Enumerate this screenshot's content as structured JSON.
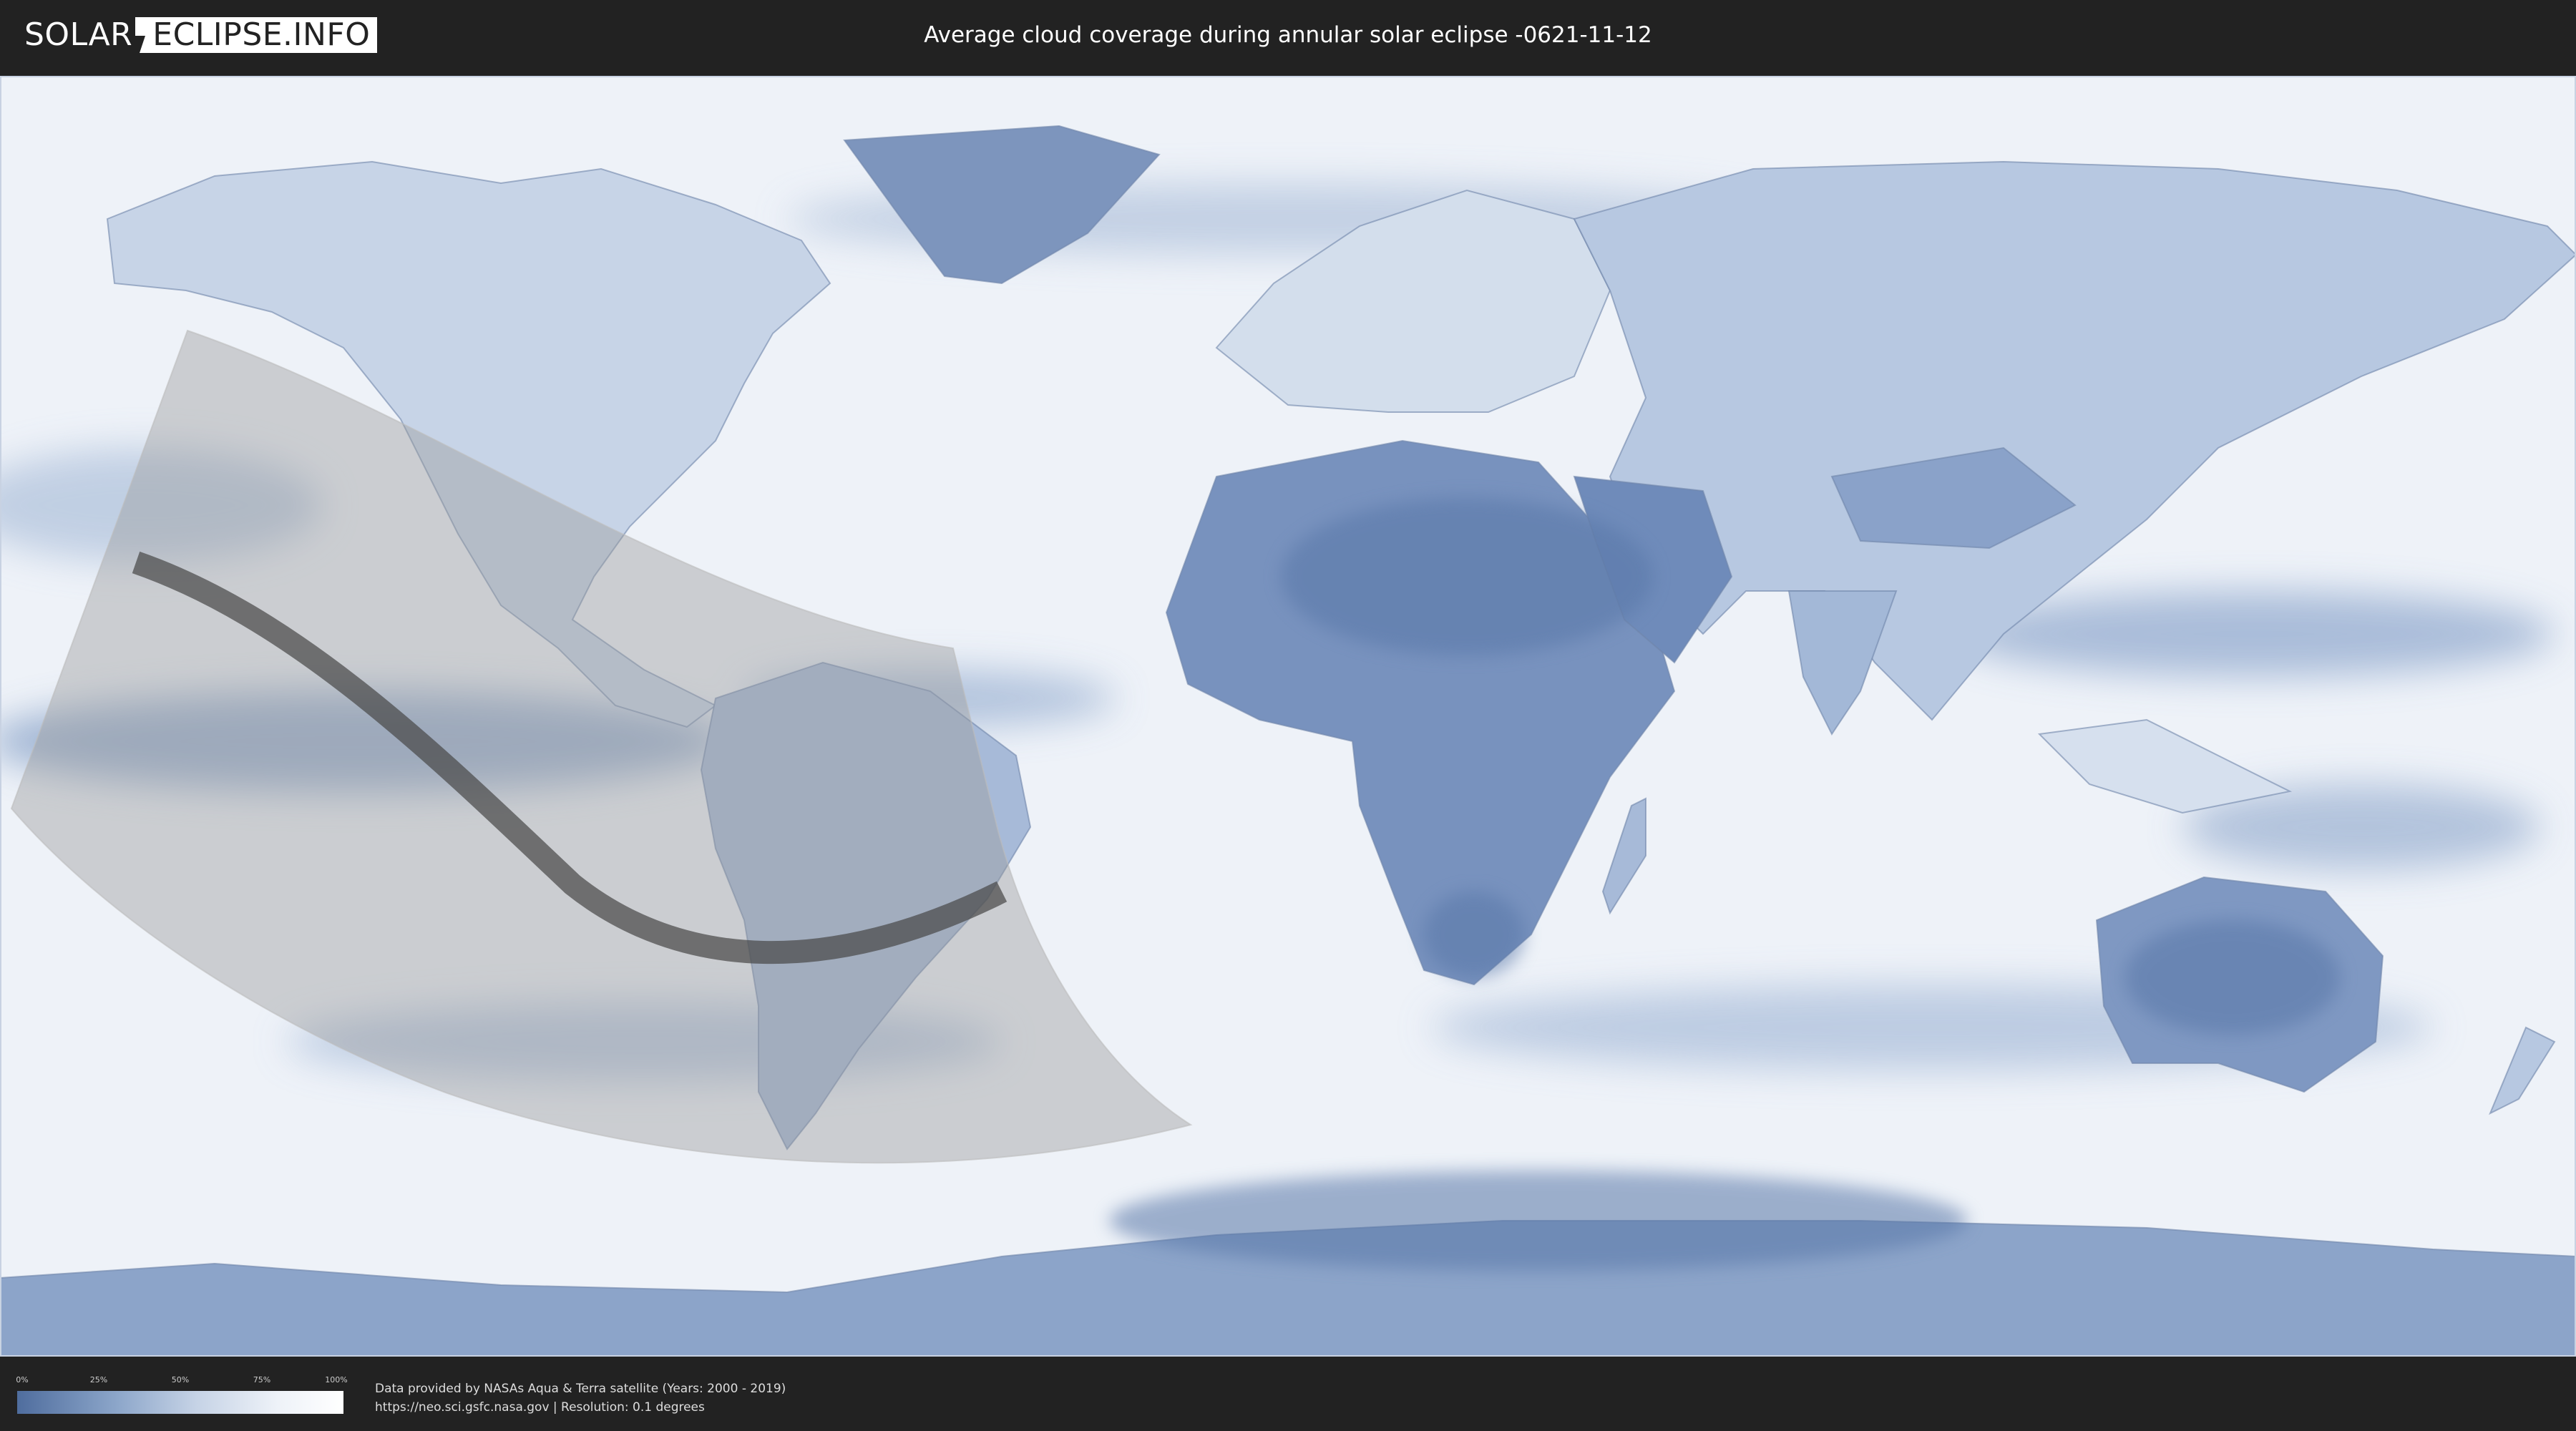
{
  "header": {
    "logo_left": "SOLAR",
    "logo_right": "ECLIPSE.INFO",
    "title": "Average cloud coverage during annular solar eclipse -0621-11-12"
  },
  "map": {
    "projection": "equirectangular",
    "ocean_color": "#eef2f8",
    "land_dry_color": "#5877a8",
    "eclipse_zone_color": "#9a9a9a",
    "eclipse_path_color": "#4a4a4a"
  },
  "legend": {
    "ticks": [
      "0%",
      "25%",
      "50%",
      "75%",
      "100%"
    ],
    "tick_values": [
      0,
      25,
      50,
      75,
      100
    ],
    "gradient_start": "#4f6d9e",
    "gradient_end": "#ffffff"
  },
  "footer": {
    "credit_line": "Data provided by NASAs Aqua & Terra satellite (Years: 2000 - 2019)",
    "source_line": "https://neo.sci.gsfc.nasa.gov | Resolution: 0.1 degrees"
  }
}
